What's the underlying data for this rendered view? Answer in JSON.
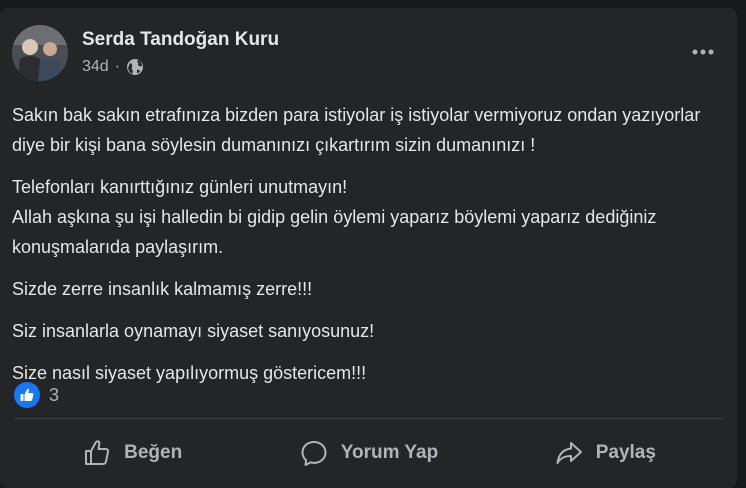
{
  "post": {
    "author": "Serda Tandoğan Kuru",
    "time": "34d",
    "separator": "·",
    "privacy_icon": "globe-icon",
    "paragraphs": [
      "Sakın bak sakın etrafınıza bizden para istiyolar iş istiyolar vermiyoruz ondan yazıyorlar diye bir kişi bana söylesin dumanınızı çıkartırım sizin dumanınızı !",
      "Telefonları kanırttığınız günleri unutmayın!\nAllah aşkına şu işi halledin bi gidip gelin öylemi yaparız böylemi yaparız dediğiniz konuşmalarıda paylaşırım.",
      "Sizde zerre insanlık kalmamış zerre!!!",
      "Siz insanlarla oynamayı siyaset sanıyosunuz!",
      "Size nasıl siyaset yapılıyormuş göstericem!!!"
    ],
    "reaction_count": "3"
  },
  "actions": {
    "like": "Beğen",
    "comment": "Yorum Yap",
    "share": "Paylaş"
  },
  "colors": {
    "card": "#242526",
    "text": "#e4e6eb",
    "secondary": "#b0b3b8",
    "accent": "#1877f2"
  }
}
